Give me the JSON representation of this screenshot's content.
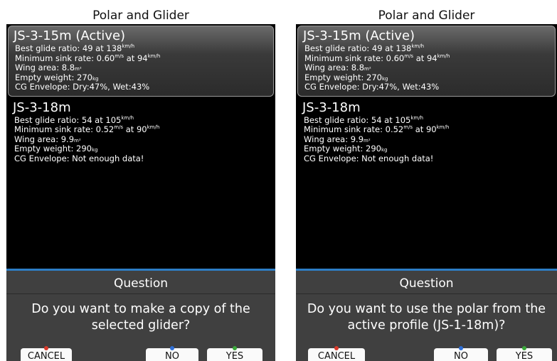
{
  "screens": [
    {
      "title": "Polar and Glider",
      "gliders": [
        {
          "name": "JS-3-15m (Active)",
          "best_glide_label": "Best glide ratio: 49 at 138",
          "best_glide_unit": "km/h",
          "min_sink_label": "Minimum sink rate: 0.60",
          "min_sink_unit": "m/s",
          "min_sink_at": " at 94",
          "min_sink_at_unit": "km/h",
          "wing_area_label": "Wing area: 8.8",
          "wing_area_unit": "m²",
          "empty_weight_label": "Empty weight: 270",
          "empty_weight_unit": "kg",
          "cg_envelope": "CG Envelope: Dry:47%, Wet:43%"
        },
        {
          "name": "JS-3-18m",
          "best_glide_label": "Best glide ratio: 54 at 105",
          "best_glide_unit": "km/h",
          "min_sink_label": "Minimum sink rate: 0.52",
          "min_sink_unit": "m/s",
          "min_sink_at": " at 90",
          "min_sink_at_unit": "km/h",
          "wing_area_label": "Wing area: 9.9",
          "wing_area_unit": "m²",
          "empty_weight_label": "Empty weight: 290",
          "empty_weight_unit": "kg",
          "cg_envelope": "CG Envelope: Not enough data!"
        }
      ],
      "dialog": {
        "title": "Question",
        "message": "Do you want to make a copy of the selected glider?",
        "cancel": "CANCEL",
        "no": "NO",
        "yes": "YES"
      }
    },
    {
      "title": "Polar and Glider",
      "gliders": [
        {
          "name": "JS-3-15m (Active)",
          "best_glide_label": "Best glide ratio: 49 at 138",
          "best_glide_unit": "km/h",
          "min_sink_label": "Minimum sink rate: 0.60",
          "min_sink_unit": "m/s",
          "min_sink_at": " at 94",
          "min_sink_at_unit": "km/h",
          "wing_area_label": "Wing area: 8.8",
          "wing_area_unit": "m²",
          "empty_weight_label": "Empty weight: 270",
          "empty_weight_unit": "kg",
          "cg_envelope": "CG Envelope: Dry:47%, Wet:43%"
        },
        {
          "name": "JS-3-18m",
          "best_glide_label": "Best glide ratio: 54 at 105",
          "best_glide_unit": "km/h",
          "min_sink_label": "Minimum sink rate: 0.52",
          "min_sink_unit": "m/s",
          "min_sink_at": " at 90",
          "min_sink_at_unit": "km/h",
          "wing_area_label": "Wing area: 9.9",
          "wing_area_unit": "m²",
          "empty_weight_label": "Empty weight: 290",
          "empty_weight_unit": "kg",
          "cg_envelope": "CG Envelope: Not enough data!"
        }
      ],
      "dialog": {
        "title": "Question",
        "message": "Do you want to use the polar from the active profile (JS-1-18m)?",
        "cancel": "CANCEL",
        "no": "NO",
        "yes": "YES"
      }
    }
  ],
  "colors": {
    "cancel_dot": "#d93a2b",
    "no_dot": "#2f6fd6",
    "yes_dot": "#3aa83a",
    "dialog_accent": "#2d7ec6"
  }
}
